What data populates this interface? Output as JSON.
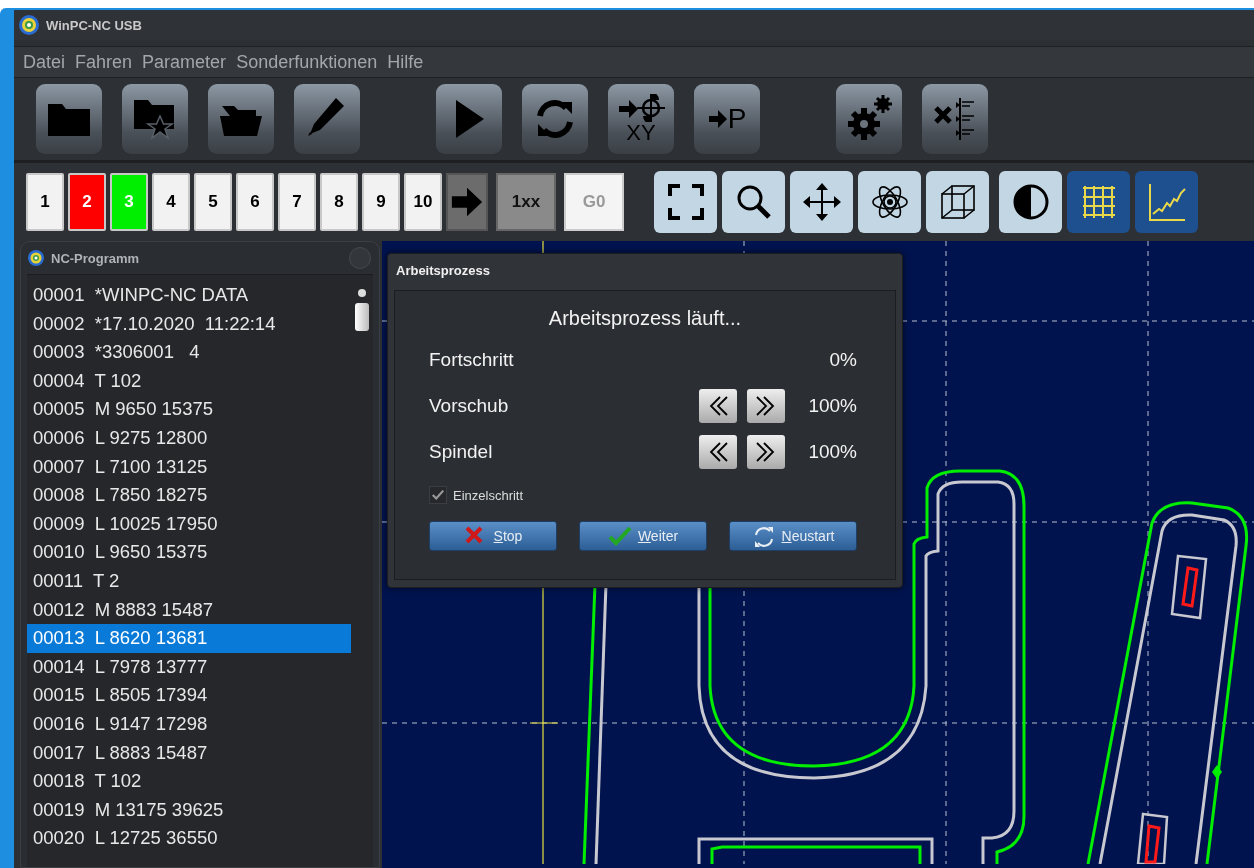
{
  "window": {
    "title": "WinPC-NC USB"
  },
  "menu": [
    "Datei",
    "Fahren",
    "Parameter",
    "Sonderfunktionen",
    "Hilfe"
  ],
  "main_toolbar": [
    {
      "buttons": [
        {
          "kind": "open"
        },
        {
          "kind": "favorites"
        },
        {
          "kind": "folder"
        },
        {
          "kind": "edit"
        }
      ]
    },
    {
      "buttons": [
        {
          "kind": "start"
        },
        {
          "kind": "repeat"
        },
        {
          "kind": "move-xy",
          "label": "XY"
        },
        {
          "kind": "move-p",
          "label": "P"
        }
      ]
    },
    {
      "buttons": [
        {
          "kind": "settings"
        },
        {
          "kind": "tools"
        }
      ]
    }
  ],
  "program_slots": [
    {
      "label": "1",
      "color": "#f2f2f2"
    },
    {
      "label": "2",
      "color": "#ff0000"
    },
    {
      "label": "3",
      "color": "#00ee00"
    },
    {
      "label": "4",
      "color": "#f2f2f2"
    },
    {
      "label": "5",
      "color": "#f2f2f2"
    },
    {
      "label": "6",
      "color": "#f2f2f2"
    },
    {
      "label": "7",
      "color": "#f2f2f2"
    },
    {
      "label": "8",
      "color": "#f2f2f2"
    },
    {
      "label": "9",
      "color": "#f2f2f2"
    },
    {
      "label": "10",
      "color": "#f2f2f2"
    }
  ],
  "mode_buttons": [
    {
      "label": "1xx",
      "selected": true
    },
    {
      "label": "G0",
      "selected": false
    }
  ],
  "view_tools": [
    {
      "kind": "fit",
      "on": false
    },
    {
      "kind": "zoom",
      "on": false
    },
    {
      "kind": "pan",
      "on": false
    },
    {
      "kind": "atom",
      "on": false
    },
    {
      "kind": "cube",
      "on": false
    },
    {
      "kind": "contrast",
      "on": false
    },
    {
      "kind": "grid",
      "on": true
    },
    {
      "kind": "chart",
      "on": true
    }
  ],
  "nc_program": {
    "title": "NC-Programm",
    "lines": [
      {
        "text": "00001  *WINPC-NC DATA",
        "selected": false
      },
      {
        "text": "00002  *17.10.2020  11:22:14",
        "selected": false
      },
      {
        "text": "00003  *3306001   4",
        "selected": false
      },
      {
        "text": "00004  T 102",
        "selected": false
      },
      {
        "text": "00005  M 9650 15375",
        "selected": false
      },
      {
        "text": "00006  L 9275 12800",
        "selected": false
      },
      {
        "text": "00007  L 7100 13125",
        "selected": false
      },
      {
        "text": "00008  L 7850 18275",
        "selected": false
      },
      {
        "text": "00009  L 10025 17950",
        "selected": false
      },
      {
        "text": "00010  L 9650 15375",
        "selected": false
      },
      {
        "text": "00011  T 2",
        "selected": false
      },
      {
        "text": "00012  M 8883 15487",
        "selected": false
      },
      {
        "text": "00013  L 8620 13681",
        "selected": true
      },
      {
        "text": "00014  L 7978 13777",
        "selected": false
      },
      {
        "text": "00015  L 8505 17394",
        "selected": false
      },
      {
        "text": "00016  L 9147 17298",
        "selected": false
      },
      {
        "text": "00017  L 8883 15487",
        "selected": false
      },
      {
        "text": "00018  T 102",
        "selected": false
      },
      {
        "text": "00019  M 13175 39625",
        "selected": false
      },
      {
        "text": "00020  L 12725 36550",
        "selected": false
      }
    ]
  },
  "dialog": {
    "title": "Arbeitsprozess",
    "heading": "Arbeitsprozess läuft...",
    "rows": [
      {
        "kind": "reading",
        "label": "Fortschritt",
        "value": "0%"
      },
      {
        "kind": "adjustable",
        "label": "Vorschub",
        "value": "100%"
      },
      {
        "kind": "adjustable",
        "label": "Spindel",
        "value": "100%"
      }
    ],
    "checkbox": {
      "label": "Einzelschritt",
      "checked": true
    },
    "buttons": [
      {
        "kind": "stop",
        "label": "Stop",
        "mnemonic": true
      },
      {
        "kind": "continue",
        "label": "Weiter",
        "mnemonic": true
      },
      {
        "kind": "restart",
        "label": "Neustart",
        "mnemonic": true
      }
    ]
  }
}
